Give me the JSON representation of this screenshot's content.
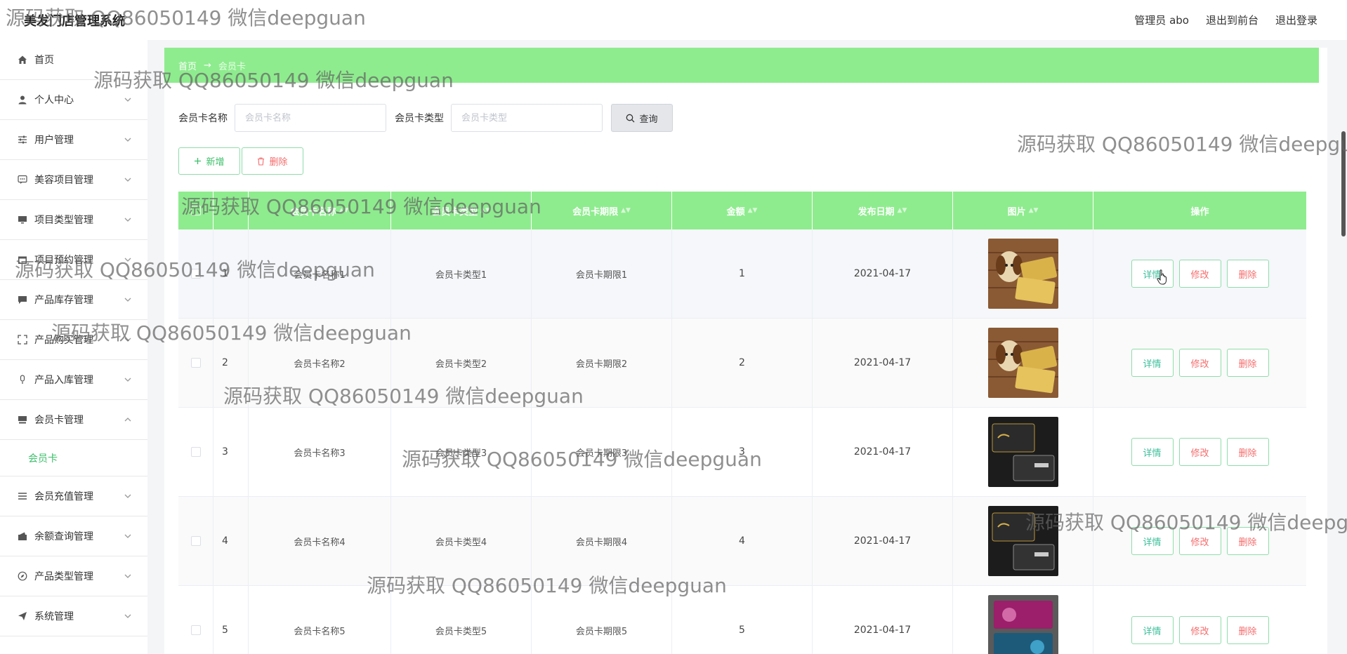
{
  "app": {
    "title": "美发门店管理系统"
  },
  "top_links": {
    "admin": "管理员 abo",
    "front": "退出到前台",
    "logout": "退出登录"
  },
  "sidebar": {
    "items": [
      {
        "label": "首页",
        "icon": "home-icon"
      },
      {
        "label": "个人中心",
        "icon": "user-icon"
      },
      {
        "label": "用户管理",
        "icon": "sliders-icon"
      },
      {
        "label": "美容项目管理",
        "icon": "chat-icon"
      },
      {
        "label": "项目类型管理",
        "icon": "monitor-icon"
      },
      {
        "label": "项目预约管理",
        "icon": "calendar-icon"
      },
      {
        "label": "产品库存管理",
        "icon": "comment-icon"
      },
      {
        "label": "产品购买管理",
        "icon": "fullscreen-icon"
      },
      {
        "label": "产品入库管理",
        "icon": "mic-icon"
      },
      {
        "label": "会员卡管理",
        "icon": "card-icon",
        "sub": "会员卡"
      },
      {
        "label": "会员充值管理",
        "icon": "menu-icon"
      },
      {
        "label": "余额查询管理",
        "icon": "wallet-icon"
      },
      {
        "label": "产品类型管理",
        "icon": "compass-icon"
      },
      {
        "label": "系统管理",
        "icon": "send-icon"
      }
    ]
  },
  "breadcrumb": {
    "home": "首页",
    "sep": "→",
    "current": "会员卡"
  },
  "search": {
    "name_label": "会员卡名称",
    "name_placeholder": "会员卡名称",
    "type_label": "会员卡类型",
    "type_placeholder": "会员卡类型",
    "query_label": "查询"
  },
  "actions": {
    "add": "新增",
    "delete": "删除"
  },
  "table": {
    "headers": [
      "会员卡名称",
      "会员卡类型",
      "会员卡期限",
      "金额",
      "发布日期",
      "图片",
      "操作"
    ],
    "op_labels": {
      "detail": "详情",
      "edit": "修改",
      "delete": "删除"
    },
    "rows": [
      {
        "idx": "1",
        "name": "会员卡名称1",
        "type": "会员卡类型1",
        "term": "会员卡期限1",
        "amount": "1",
        "date": "2021-04-17"
      },
      {
        "idx": "2",
        "name": "会员卡名称2",
        "type": "会员卡类型2",
        "term": "会员卡期限2",
        "amount": "2",
        "date": "2021-04-17"
      },
      {
        "idx": "3",
        "name": "会员卡名称3",
        "type": "会员卡类型3",
        "term": "会员卡期限3",
        "amount": "3",
        "date": "2021-04-17"
      },
      {
        "idx": "4",
        "name": "会员卡名称4",
        "type": "会员卡类型4",
        "term": "会员卡期限4",
        "amount": "4",
        "date": "2021-04-17"
      },
      {
        "idx": "5",
        "name": "会员卡名称5",
        "type": "会员卡类型5",
        "term": "会员卡期限5",
        "amount": "5",
        "date": "2021-04-17"
      }
    ]
  },
  "watermark": "源码获取 QQ86050149 微信deepguan",
  "colors": {
    "accent": "#8eec8e",
    "accent_text": "#3cbf6a",
    "danger": "#f56c6c"
  }
}
